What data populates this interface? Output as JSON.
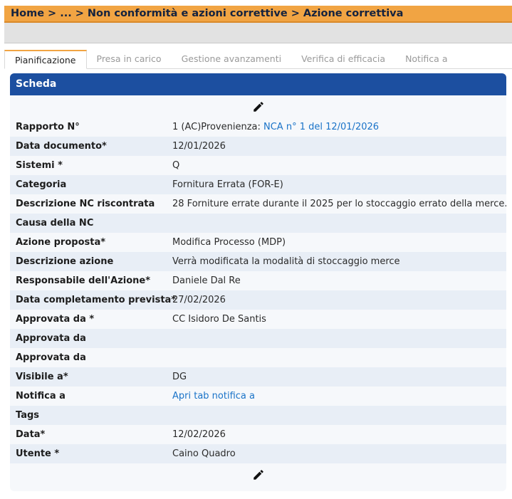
{
  "breadcrumb": {
    "home": "Home",
    "sep1": ">",
    "ellipsis": "...",
    "sep2": ">",
    "section": "Non conformità e azioni correttive",
    "sep3": ">",
    "current": "Azione correttiva"
  },
  "tabs": [
    {
      "label": "Pianificazione",
      "active": true
    },
    {
      "label": "Presa in carico",
      "active": false
    },
    {
      "label": "Gestione avanzamenti",
      "active": false
    },
    {
      "label": "Verifica di efficacia",
      "active": false
    },
    {
      "label": "Notifica a",
      "active": false
    }
  ],
  "card": {
    "title": "Scheda",
    "edit_icon": "pencil-icon",
    "fields": [
      {
        "label": "Rapporto N°",
        "value": "1 (AC)Provenienza: ",
        "link": "NCA n° 1 del 12/01/2026"
      },
      {
        "label": "Data documento*",
        "value": "12/01/2026"
      },
      {
        "label": "Sistemi *",
        "value": "Q"
      },
      {
        "label": "Categoria",
        "value": "Fornitura Errata (FOR-E)"
      },
      {
        "label": "Descrizione NC riscontrata",
        "value": "28 Forniture errate durante il 2025 per lo stoccaggio errato della merce."
      },
      {
        "label": "Causa della NC",
        "value": ""
      },
      {
        "label": "Azione proposta*",
        "value": "Modifica Processo (MDP)"
      },
      {
        "label": "Descrizione azione",
        "value": "Verrà modificata la modalità di stoccaggio merce"
      },
      {
        "label": "Responsabile dell'Azione*",
        "value": "Daniele Dal Re"
      },
      {
        "label": "Data completamento prevista*",
        "value": "27/02/2026"
      },
      {
        "label": "Approvata da *",
        "value": "CC Isidoro De Santis"
      },
      {
        "label": "Approvata da",
        "value": ""
      },
      {
        "label": "Approvata da",
        "value": ""
      },
      {
        "label": "Visibile a*",
        "value": "DG"
      },
      {
        "label": "Notifica a",
        "value": "",
        "link": "Apri tab notifica a"
      },
      {
        "label": "Tags",
        "value": ""
      },
      {
        "label": "Data*",
        "value": "12/02/2026"
      },
      {
        "label": "Utente *",
        "value": "Caino Quadro"
      }
    ]
  }
}
